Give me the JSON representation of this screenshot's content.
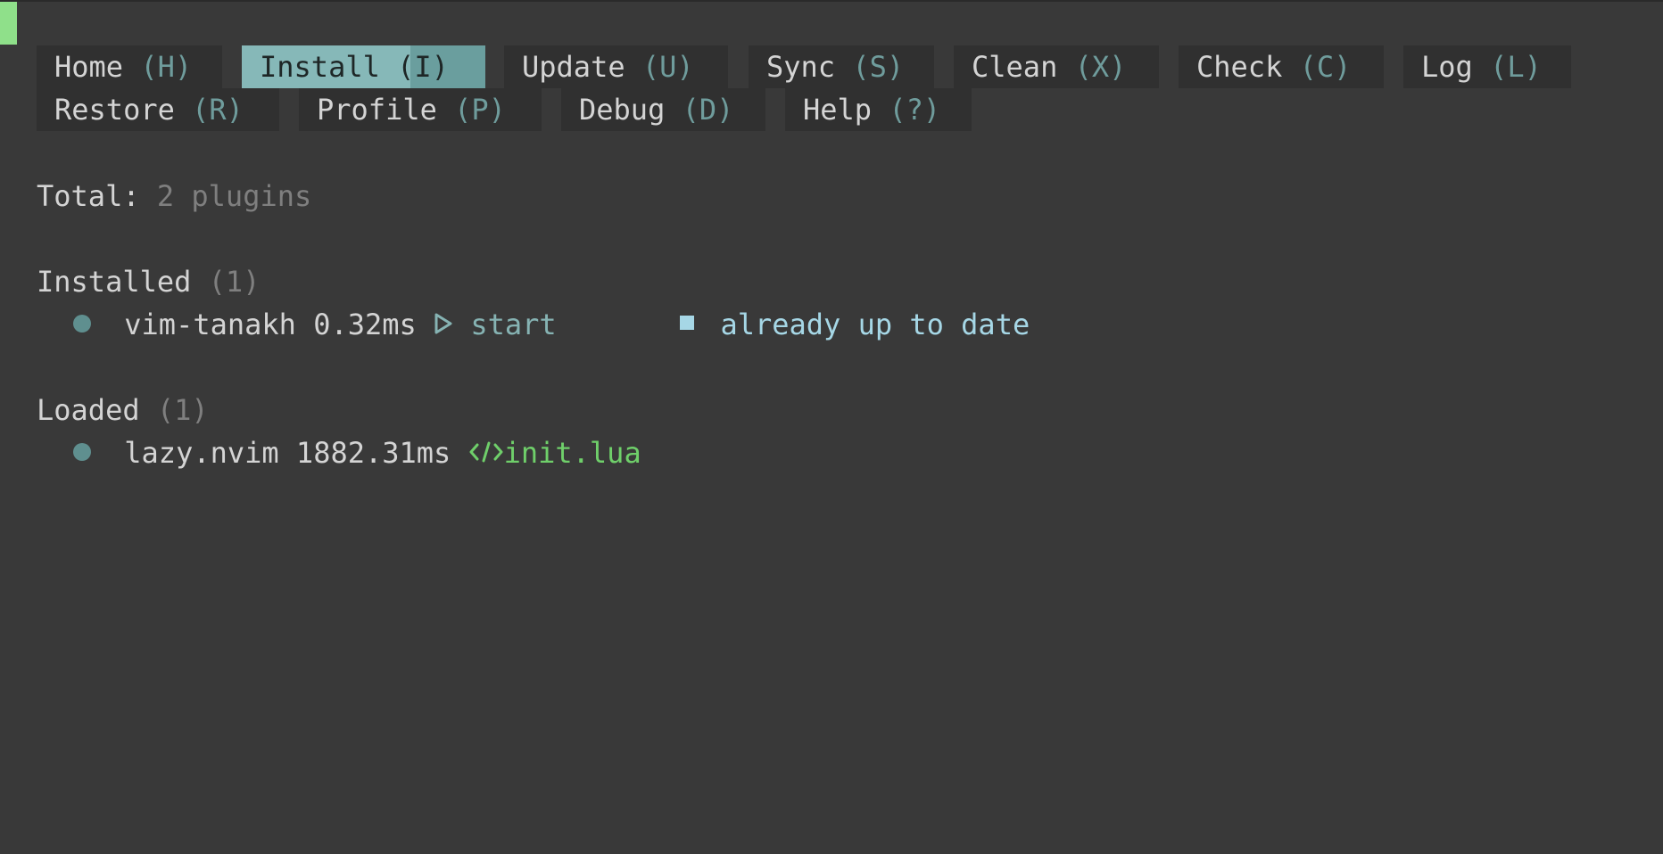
{
  "tabs": [
    {
      "label": "Home",
      "key": "(H)"
    },
    {
      "label": "Install",
      "key": "(I)"
    },
    {
      "label": "Update",
      "key": "(U)"
    },
    {
      "label": "Sync",
      "key": "(S)"
    },
    {
      "label": "Clean",
      "key": "(X)"
    },
    {
      "label": "Check",
      "key": "(C)"
    },
    {
      "label": "Log",
      "key": "(L)"
    },
    {
      "label": "Restore",
      "key": "(R)"
    },
    {
      "label": "Profile",
      "key": "(P)"
    },
    {
      "label": "Debug",
      "key": "(D)"
    },
    {
      "label": "Help",
      "key": "(?)"
    }
  ],
  "active_tab": "Install",
  "total": {
    "label": "Total:",
    "value": "2 plugins"
  },
  "sections": {
    "installed": {
      "title": "Installed",
      "count": "(1)",
      "plugin": {
        "name": "vim-tanakh",
        "time": "0.32ms",
        "trigger_icon": "play-outline-icon",
        "trigger": "start",
        "status_icon": "square-icon",
        "status": "already up to date"
      }
    },
    "loaded": {
      "title": "Loaded",
      "count": "(1)",
      "plugin": {
        "name": "lazy.nvim",
        "time": "1882.31ms",
        "source_icon": "code-icon",
        "source": "init.lua"
      }
    }
  },
  "colors": {
    "background": "#393939",
    "active_tab": "#86b8b8",
    "key_hint": "#6f9c9c",
    "status_text": "#a6d7e6",
    "source_text": "#6fcf6a",
    "cursor": "#8fe08a"
  }
}
